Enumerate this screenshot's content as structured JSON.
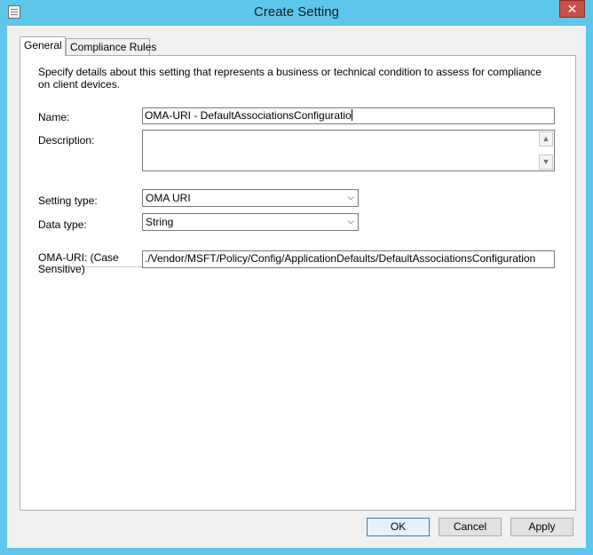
{
  "window": {
    "title": "Create Setting",
    "close_glyph": "✕"
  },
  "tabs": [
    {
      "label": "General",
      "selected": true
    },
    {
      "label": "Compliance Rules",
      "selected": false
    }
  ],
  "general": {
    "intro": "Specify details about this setting that represents a business or technical condition to assess for compliance on client devices.",
    "name": {
      "label": "Name:",
      "value": "OMA-URI - DefaultAssociationsConfiguratio"
    },
    "description": {
      "label": "Description:",
      "value": ""
    },
    "setting_type": {
      "label": "Setting type:",
      "value": "OMA URI"
    },
    "data_type": {
      "label": "Data type:",
      "value": "String"
    },
    "oma_uri": {
      "label_line1": "OMA-URI: (Case",
      "label_line2": "Sensitive)",
      "value": "./Vendor/MSFT/Policy/Config/ApplicationDefaults/DefaultAssociationsConfiguration"
    }
  },
  "buttons": {
    "ok": "OK",
    "cancel": "Cancel",
    "apply": "Apply"
  },
  "icons": {
    "app": "document-icon",
    "close": "close-icon",
    "scroll_up": "chevron-up-icon",
    "scroll_down": "chevron-down-icon",
    "dropdown": "chevron-down-icon"
  },
  "colors": {
    "frame": "#5ec6ea",
    "close_button": "#c7504a",
    "panel": "#ffffff",
    "dialog_bg": "#f0f0f0"
  }
}
